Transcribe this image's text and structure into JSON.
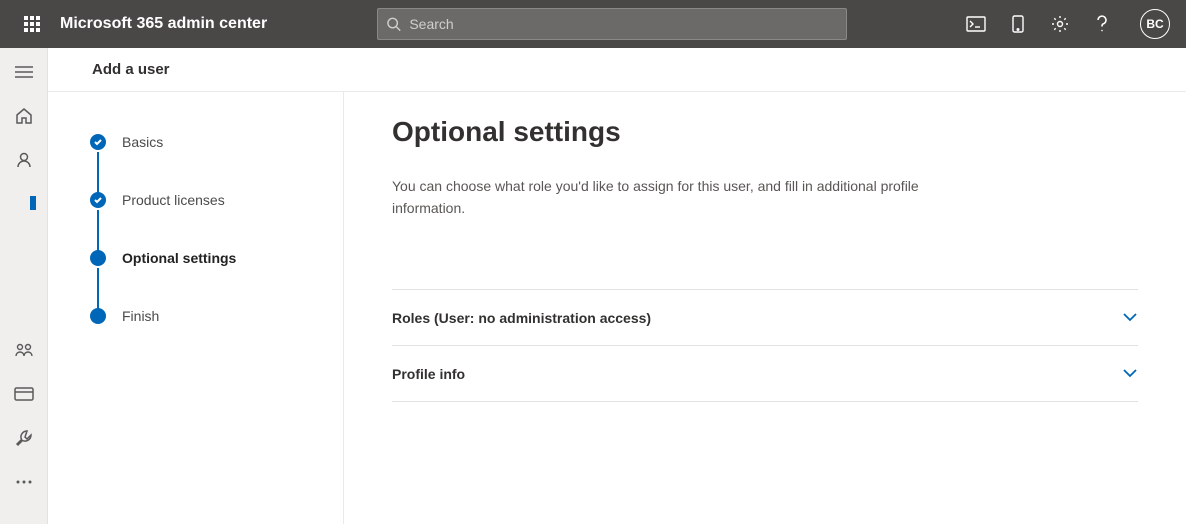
{
  "header": {
    "title": "Microsoft 365 admin center",
    "search_placeholder": "Search",
    "avatar_initials": "BC"
  },
  "panel": {
    "title": "Add a user"
  },
  "steps": [
    {
      "label": "Basics",
      "state": "done"
    },
    {
      "label": "Product licenses",
      "state": "done"
    },
    {
      "label": "Optional settings",
      "state": "current"
    },
    {
      "label": "Finish",
      "state": "upcoming"
    }
  ],
  "content": {
    "heading": "Optional settings",
    "description": "You can choose what role you'd like to assign for this user, and fill in additional profile information."
  },
  "accordion": {
    "roles_label": "Roles (User: no administration access)",
    "profile_label": "Profile info"
  }
}
